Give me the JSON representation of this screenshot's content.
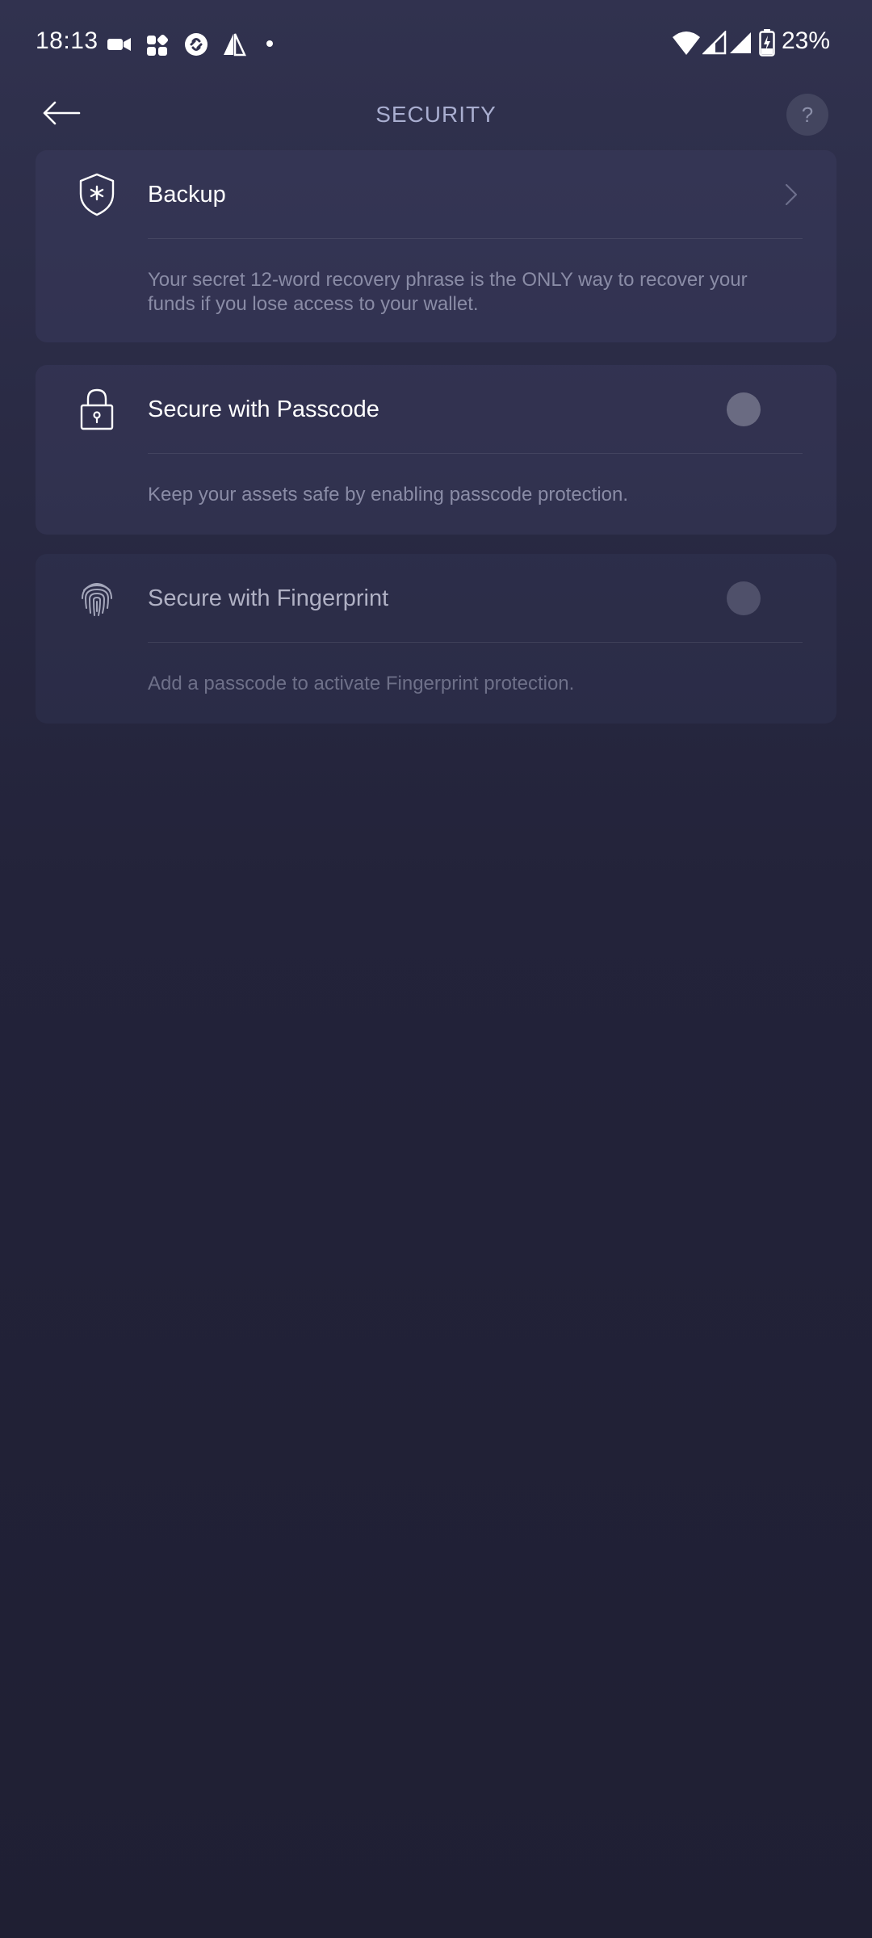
{
  "status_bar": {
    "time": "18:13",
    "battery_percent": "23%",
    "notification_icons": [
      "video-camera-icon",
      "apps-grid-icon",
      "shazam-icon",
      "sail-icon",
      "dot-icon"
    ],
    "system_icons": [
      "wifi-icon",
      "signal-1-icon",
      "signal-2-icon",
      "battery-charging-icon"
    ]
  },
  "header": {
    "title": "SECURITY",
    "help_label": "?"
  },
  "cards": [
    {
      "title": "Backup",
      "icon": "shield-asterisk-icon",
      "description": "Your secret 12-word recovery phrase is the ONLY way to recover your funds if you lose access to your wallet.",
      "control": "chevron"
    },
    {
      "title": "Secure with Passcode",
      "icon": "lock-icon",
      "description": "Keep your assets safe by enabling passcode protection.",
      "control": "toggle",
      "enabled": false
    },
    {
      "title": "Secure with Fingerprint",
      "icon": "fingerprint-icon",
      "description": "Add a passcode to activate Fingerprint protection.",
      "control": "toggle",
      "enabled": false,
      "disabled": true
    }
  ],
  "colors": {
    "background_top": "#31324f",
    "background_bottom": "#1f1f33",
    "card": "#3e4064",
    "title_text": "#a9aed0",
    "description_text": "#8a8ca6"
  }
}
